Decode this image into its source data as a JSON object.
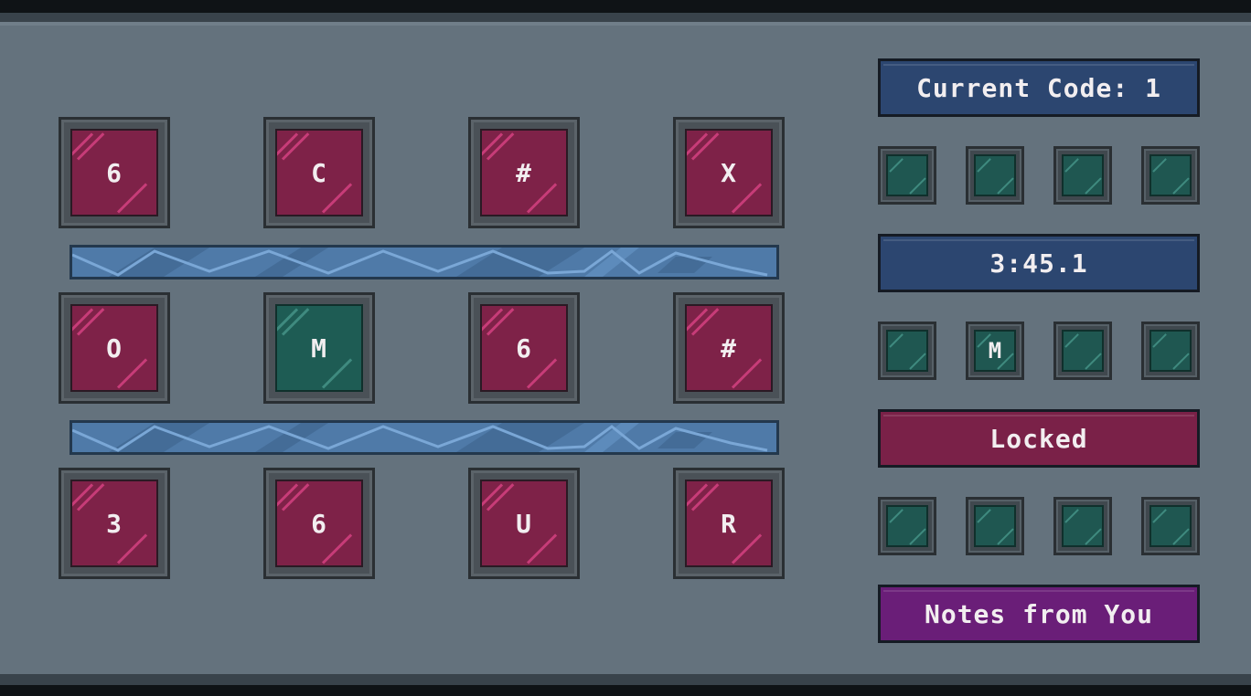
{
  "code_display": "Current Code: 1",
  "timer": "3:45.1",
  "lock_status": "Locked",
  "notes_button": "Notes from You",
  "grid": [
    [
      {
        "label": "6",
        "color": "red"
      },
      {
        "label": "C",
        "color": "red"
      },
      {
        "label": "#",
        "color": "red"
      },
      {
        "label": "X",
        "color": "red"
      }
    ],
    [
      {
        "label": "O",
        "color": "red"
      },
      {
        "label": "M",
        "color": "green"
      },
      {
        "label": "6",
        "color": "red"
      },
      {
        "label": "#",
        "color": "red"
      }
    ],
    [
      {
        "label": "3",
        "color": "red"
      },
      {
        "label": "6",
        "color": "red"
      },
      {
        "label": "U",
        "color": "red"
      },
      {
        "label": "R",
        "color": "red"
      }
    ]
  ],
  "code_slots": [
    [
      "",
      "",
      "",
      ""
    ],
    [
      "",
      "M",
      "",
      ""
    ],
    [
      "",
      "",
      "",
      ""
    ]
  ],
  "colors": {
    "tile_red": "#7e2248",
    "tile_green": "#1e5c54",
    "panel_bg": "#64727d",
    "code_box": "#2c4670",
    "timer_box": "#2c4670",
    "locked_box": "#7a2148",
    "notes_box": "#6a1e78",
    "beam": "#4f7aa8"
  },
  "icons": {
    "tile_shine": "glass-shine-icon",
    "beam_pattern": "electric-zigzag-icon"
  }
}
